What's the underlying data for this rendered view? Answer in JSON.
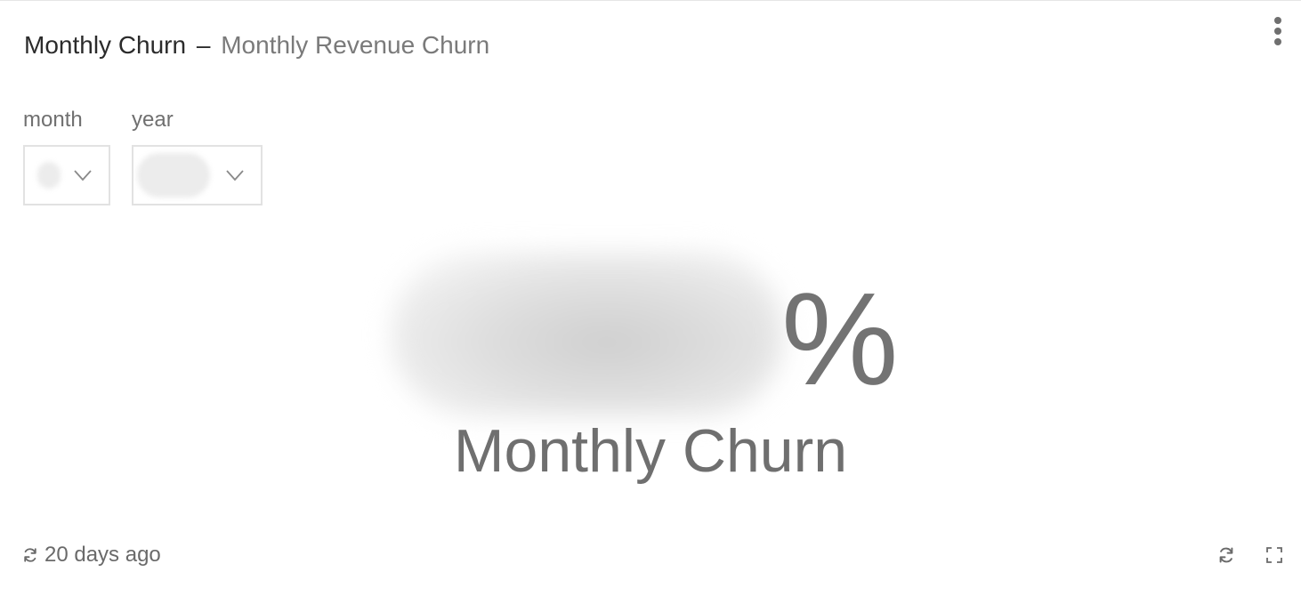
{
  "header": {
    "title": "Monthly Churn",
    "separator": "–",
    "subtitle": "Monthly Revenue Churn"
  },
  "menu": {
    "icon": "kebab-menu-icon"
  },
  "filters": {
    "month": {
      "label": "month",
      "value_state": "redacted"
    },
    "year": {
      "label": "year",
      "value_state": "redacted"
    }
  },
  "metric": {
    "value_state": "redacted",
    "unit": "%",
    "label": "Monthly Churn"
  },
  "footer": {
    "updated": "20 days ago",
    "refresh_icon": "refresh-icon",
    "expand_icon": "expand-icon"
  },
  "colors": {
    "title": "#2b2b2b",
    "subtitle": "#7a7a7a",
    "metric_text": "#737373",
    "border": "#e2e2e2"
  }
}
